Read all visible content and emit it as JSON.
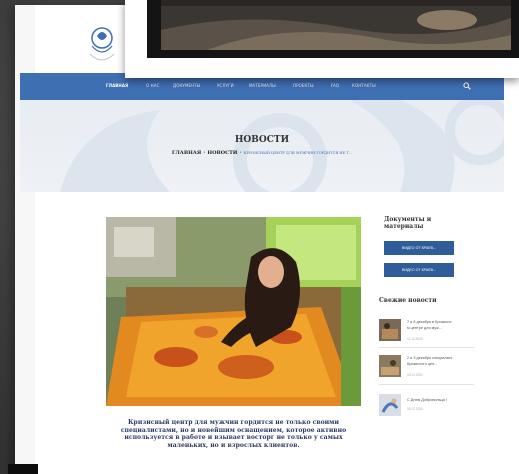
{
  "nav": {
    "items": [
      "ГЛАВНАЯ",
      "О НАС",
      "ДОКУМЕНТЫ",
      "УСЛУГИ",
      "МАТЕРИАЛЫ",
      "ПРОЕКТЫ",
      "FAQ",
      "КОНТАКТЫ"
    ]
  },
  "hero": {
    "title": "НОВОСТИ",
    "crumb_home": "ГЛАВНАЯ",
    "crumb_section": "НОВОСТИ",
    "crumb_current": "КРИЗИСНЫЙ ЦЕНТР ДЛЯ МУЖЧИН ГОРДИТСЯ НЕ Т...",
    "separator": "•"
  },
  "caption": [
    "Кризисный центр для мужчин гордится не только своими",
    "специалистами, но и новейшим оснащением, которое активно",
    "используется в работе и взывает восторг не только у самых",
    "маленьких, но и взрослых клиентов."
  ],
  "sidebar": {
    "docs_heading_1": "Документы и",
    "docs_heading_2": "материалы",
    "buttons": [
      "ВИДЕО ОТ КРАЕВ...",
      "ВИДЕО ОТ КРАЕВ..."
    ],
    "news_heading": "Свежие новости",
    "news": [
      {
        "title_1": "7 и 8 декабря в Кризисно",
        "title_2": "м центре для муж...",
        "date": "11.12.2020"
      },
      {
        "title_1": "2 и 3 декабря специалист",
        "title_2": "Кризисного цен...",
        "date": "03.12.2020"
      },
      {
        "title_1": "С Днем Добровольца !",
        "title_2": "",
        "date": "05.12.2020"
      }
    ]
  },
  "colors": {
    "nav": "#3f6fb3",
    "button": "#2f5d99",
    "caption": "#2b3a67"
  }
}
